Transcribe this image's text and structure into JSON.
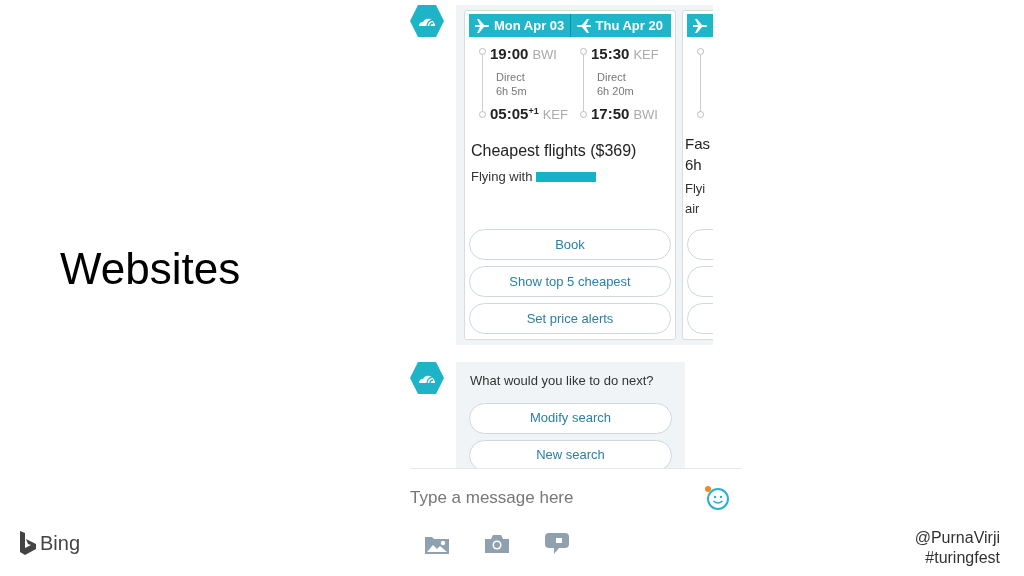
{
  "slide_title": "Websites",
  "chat": {
    "flight_card": {
      "legs": [
        {
          "date": "Mon Apr 03",
          "kind": "outbound",
          "depart_time": "19:00",
          "depart_airport": "BWI",
          "stops": "Direct",
          "duration": "6h 5m",
          "arrive_time": "05:05",
          "arrive_offset": "+1",
          "arrive_airport": "KEF"
        },
        {
          "date": "Thu Apr 20",
          "kind": "return",
          "depart_time": "15:30",
          "depart_airport": "KEF",
          "stops": "Direct",
          "duration": "6h 20m",
          "arrive_time": "17:50",
          "arrive_airport": "BWI"
        }
      ],
      "heading": "Cheapest flights ($369)",
      "airline_label": "Flying with",
      "buttons": [
        "Book",
        "Show top 5 cheapest",
        "Set price alerts"
      ]
    },
    "next_card": {
      "heading_lines": [
        "Fas",
        "6h"
      ],
      "subtitle_lines": [
        "Flyi",
        "air"
      ]
    },
    "message": {
      "text": "What would you like to do next?",
      "buttons": [
        "Modify search",
        "New search"
      ]
    },
    "composer": {
      "placeholder": "Type a message here"
    }
  },
  "footer": {
    "brand": "Bing",
    "handle": "@PurnaVirji",
    "hashtag": "#turingfest"
  }
}
